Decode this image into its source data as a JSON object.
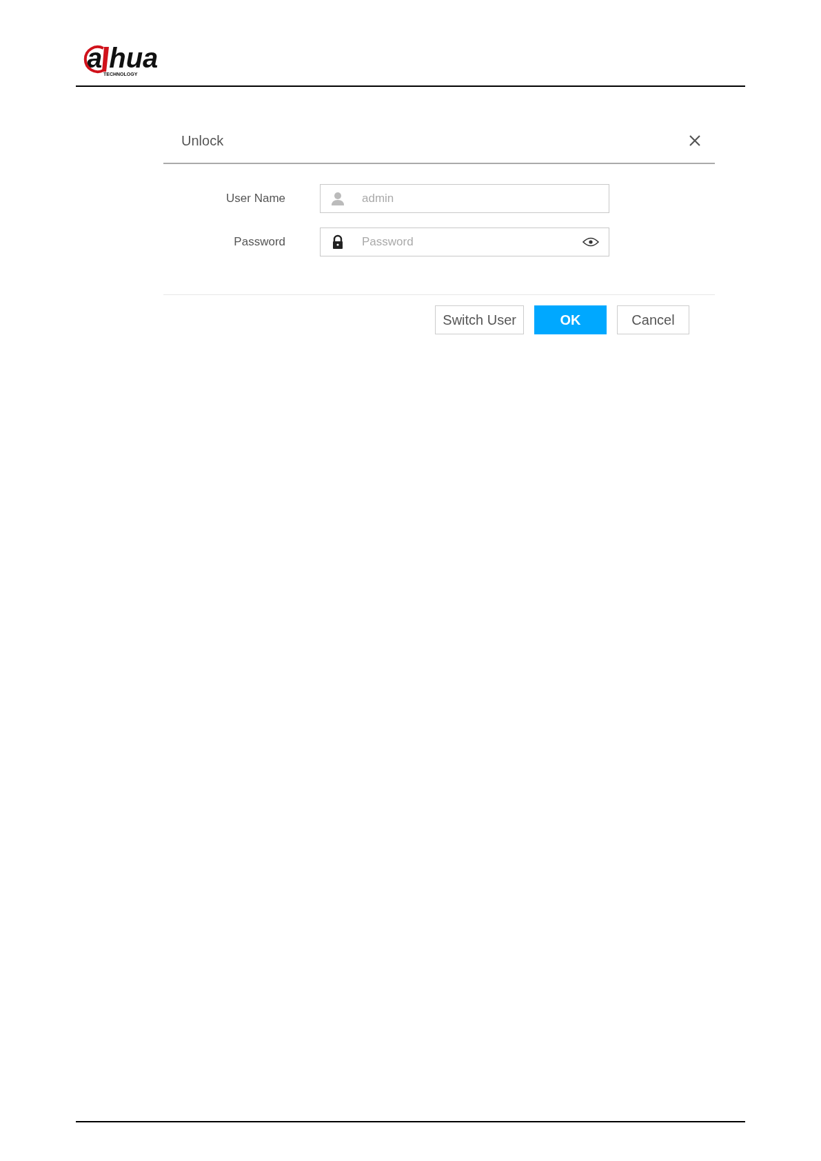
{
  "logo": {
    "parts": [
      "a",
      "hua"
    ],
    "tagline": "TECHNOLOGY"
  },
  "dialog": {
    "title": "Unlock",
    "fields": [
      {
        "kind": "user",
        "label": "User Name",
        "value": "admin",
        "disabled": true
      },
      {
        "kind": "password",
        "label": "Password",
        "placeholder": "Password"
      }
    ],
    "buttons": [
      {
        "label": "Switch User",
        "primary": false
      },
      {
        "label": "OK",
        "primary": true
      },
      {
        "label": "Cancel",
        "primary": false
      }
    ]
  }
}
